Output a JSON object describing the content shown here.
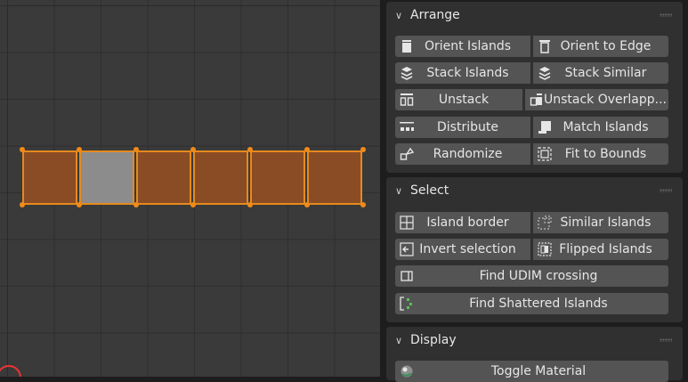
{
  "arrange": {
    "title": "Arrange",
    "buttons": {
      "orient_islands": "Orient Islands",
      "orient_to_edge": "Orient to Edge",
      "stack_islands": "Stack Islands",
      "stack_similar": "Stack Similar",
      "unstack": "Unstack",
      "unstack_overlapping": "Unstack Overlapp...",
      "distribute": "Distribute",
      "match_islands": "Match Islands",
      "randomize": "Randomize",
      "fit_to_bounds": "Fit to Bounds"
    }
  },
  "select": {
    "title": "Select",
    "buttons": {
      "island_border": "Island border",
      "similar_islands": "Similar Islands",
      "invert_selection": "Invert selection",
      "flipped_islands": "Flipped Islands",
      "find_udim_crossing": "Find UDIM crossing",
      "find_shattered_islands": "Find Shattered Islands"
    }
  },
  "display": {
    "title": "Display",
    "buttons": {
      "toggle_material": "Toggle Material"
    }
  },
  "colors": {
    "island_fill": "#8a4c25",
    "island_edge": "#e58a1e",
    "selected_island": "#8c8c8c",
    "annotation_arrow": "#e02020",
    "button_bg": "#545454",
    "panel_bg": "#303030"
  }
}
